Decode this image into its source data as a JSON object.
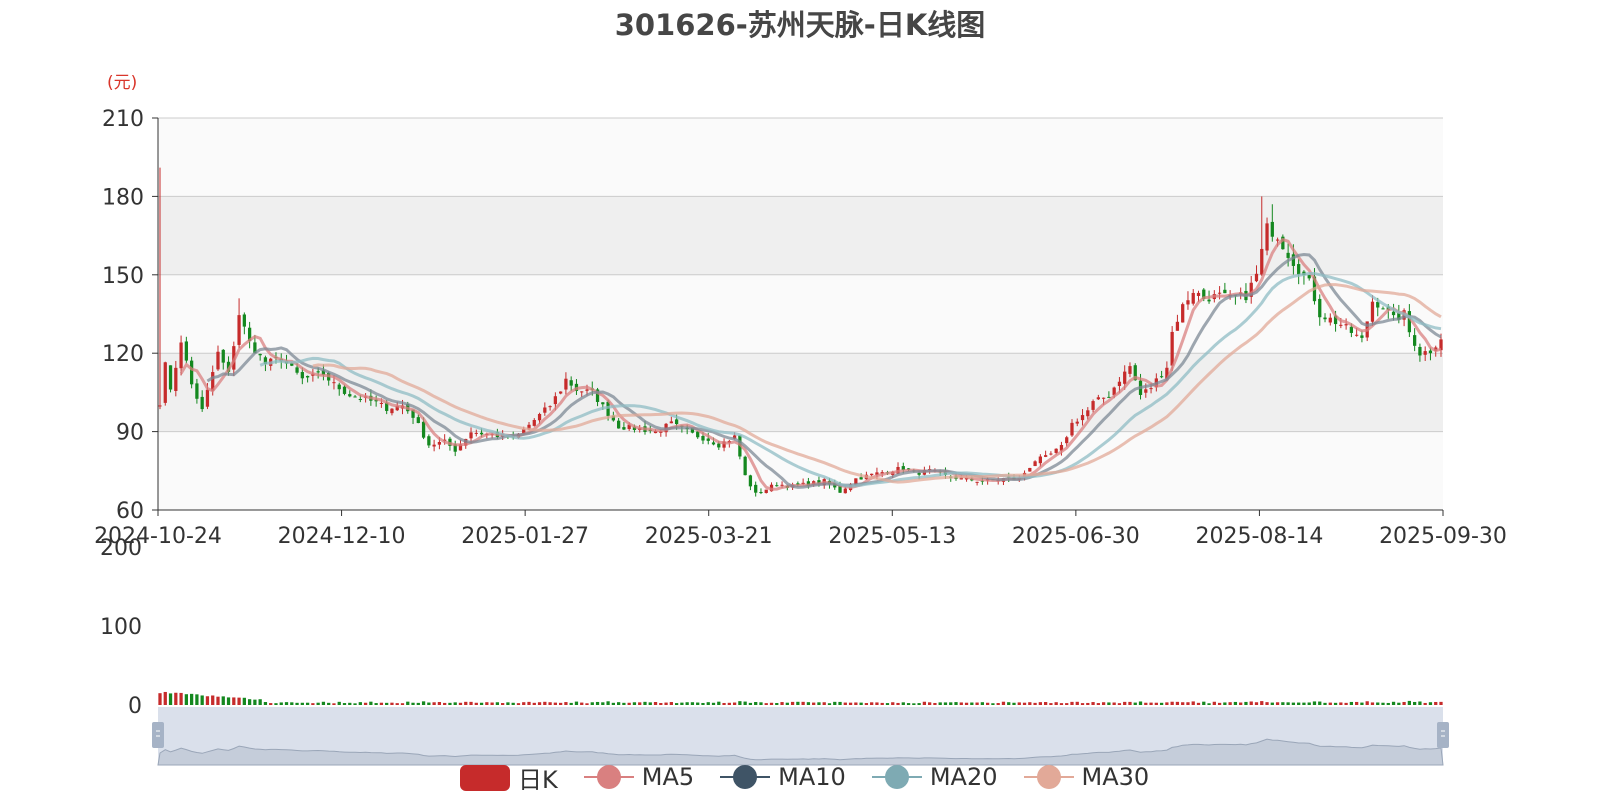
{
  "chart_data": {
    "type": "candlestick",
    "title": "301626-苏州天脉-日K线图",
    "y_unit": "(元)",
    "ylim": [
      60,
      210
    ],
    "yticks": [
      60,
      90,
      120,
      150,
      180,
      210
    ],
    "volume_ylim": [
      0,
      200
    ],
    "volume_yticks": [
      0,
      100,
      200
    ],
    "x_tick_labels": [
      "2024-10-24",
      "2024-12-10",
      "2025-01-27",
      "2025-03-21",
      "2025-05-13",
      "2025-06-30",
      "2025-08-14",
      "2025-09-30"
    ],
    "grid": true,
    "legend_position": "bottom",
    "legend": [
      "日K",
      "MA5",
      "MA10",
      "MA20",
      "MA30"
    ],
    "colors": {
      "up": "#c62b2b",
      "down": "#14881f",
      "ma5": "#d98080",
      "ma10": "#7d8a96",
      "ma20": "#8fbcc4",
      "ma30": "#e2a998",
      "title": "#464646",
      "unit": "#d9362b",
      "slider": "#d3dbe8"
    },
    "close_anchors": [
      [
        "2024-10-24",
        100
      ],
      [
        "2024-10-25",
        118
      ],
      [
        "2024-10-28",
        105
      ],
      [
        "2024-10-30",
        125
      ],
      [
        "2024-11-01",
        108
      ],
      [
        "2024-11-05",
        98
      ],
      [
        "2024-11-08",
        120
      ],
      [
        "2024-11-12",
        112
      ],
      [
        "2024-11-14",
        135
      ],
      [
        "2024-11-18",
        124
      ],
      [
        "2024-11-21",
        116
      ],
      [
        "2024-11-26",
        118
      ],
      [
        "2024-12-02",
        110
      ],
      [
        "2024-12-06",
        112
      ],
      [
        "2024-12-10",
        108
      ],
      [
        "2024-12-13",
        104
      ],
      [
        "2024-12-17",
        103
      ],
      [
        "2024-12-20",
        101
      ],
      [
        "2024-12-24",
        99
      ],
      [
        "2024-12-27",
        100
      ],
      [
        "2024-12-31",
        96
      ],
      [
        "2025-01-03",
        85
      ],
      [
        "2025-01-08",
        86
      ],
      [
        "2025-01-10",
        83
      ],
      [
        "2025-01-15",
        90
      ],
      [
        "2025-01-20",
        89
      ],
      [
        "2025-01-24",
        88
      ],
      [
        "2025-01-27",
        87
      ],
      [
        "2025-02-05",
        100
      ],
      [
        "2025-02-07",
        106
      ],
      [
        "2025-02-10",
        110
      ],
      [
        "2025-02-12",
        106
      ],
      [
        "2025-02-17",
        105
      ],
      [
        "2025-02-20",
        97
      ],
      [
        "2025-02-24",
        92
      ],
      [
        "2025-02-28",
        91
      ],
      [
        "2025-03-05",
        90
      ],
      [
        "2025-03-10",
        93
      ],
      [
        "2025-03-14",
        89
      ],
      [
        "2025-03-19",
        87
      ],
      [
        "2025-03-21",
        85
      ],
      [
        "2025-03-26",
        88
      ],
      [
        "2025-03-28",
        73
      ],
      [
        "2025-04-01",
        66
      ],
      [
        "2025-04-07",
        70
      ],
      [
        "2025-04-10",
        69
      ],
      [
        "2025-04-15",
        70
      ],
      [
        "2025-04-18",
        71
      ],
      [
        "2025-04-23",
        67
      ],
      [
        "2025-04-28",
        72
      ],
      [
        "2025-05-06",
        75
      ],
      [
        "2025-05-09",
        76
      ],
      [
        "2025-05-13",
        74
      ],
      [
        "2025-05-16",
        75
      ],
      [
        "2025-05-21",
        73
      ],
      [
        "2025-05-26",
        72
      ],
      [
        "2025-05-30",
        71
      ],
      [
        "2025-06-05",
        72
      ],
      [
        "2025-06-10",
        72
      ],
      [
        "2025-06-13",
        79
      ],
      [
        "2025-06-17",
        80
      ],
      [
        "2025-06-20",
        84
      ],
      [
        "2025-06-24",
        93
      ],
      [
        "2025-06-27",
        98
      ],
      [
        "2025-06-30",
        101
      ],
      [
        "2025-07-03",
        104
      ],
      [
        "2025-07-07",
        110
      ],
      [
        "2025-07-09",
        115
      ],
      [
        "2025-07-11",
        104
      ],
      [
        "2025-07-15",
        107
      ],
      [
        "2025-07-18",
        115
      ],
      [
        "2025-07-21",
        128
      ],
      [
        "2025-07-23",
        138
      ],
      [
        "2025-07-25",
        144
      ],
      [
        "2025-07-29",
        141
      ],
      [
        "2025-08-01",
        142
      ],
      [
        "2025-08-05",
        141
      ],
      [
        "2025-08-08",
        142
      ],
      [
        "2025-08-12",
        150
      ],
      [
        "2025-08-14",
        168
      ],
      [
        "2025-08-18",
        165
      ],
      [
        "2025-08-20",
        158
      ],
      [
        "2025-08-22",
        152
      ],
      [
        "2025-08-26",
        147
      ],
      [
        "2025-08-28",
        135
      ],
      [
        "2025-09-01",
        133
      ],
      [
        "2025-09-03",
        131
      ],
      [
        "2025-09-05",
        128
      ],
      [
        "2025-09-09",
        125
      ],
      [
        "2025-09-11",
        140
      ],
      [
        "2025-09-15",
        138
      ],
      [
        "2025-09-17",
        133
      ],
      [
        "2025-09-19",
        135
      ],
      [
        "2025-09-22",
        128
      ],
      [
        "2025-09-24",
        120
      ],
      [
        "2025-09-26",
        121
      ],
      [
        "2025-09-30",
        126
      ]
    ],
    "high_spikes": [
      [
        "2024-10-24",
        191
      ],
      [
        "2024-11-14",
        141
      ],
      [
        "2025-08-13",
        180
      ],
      [
        "2025-08-15",
        177
      ]
    ]
  },
  "legend_items": {
    "k": "日K",
    "ma5": "MA5",
    "ma10": "MA10",
    "ma20": "MA20",
    "ma30": "MA30"
  }
}
